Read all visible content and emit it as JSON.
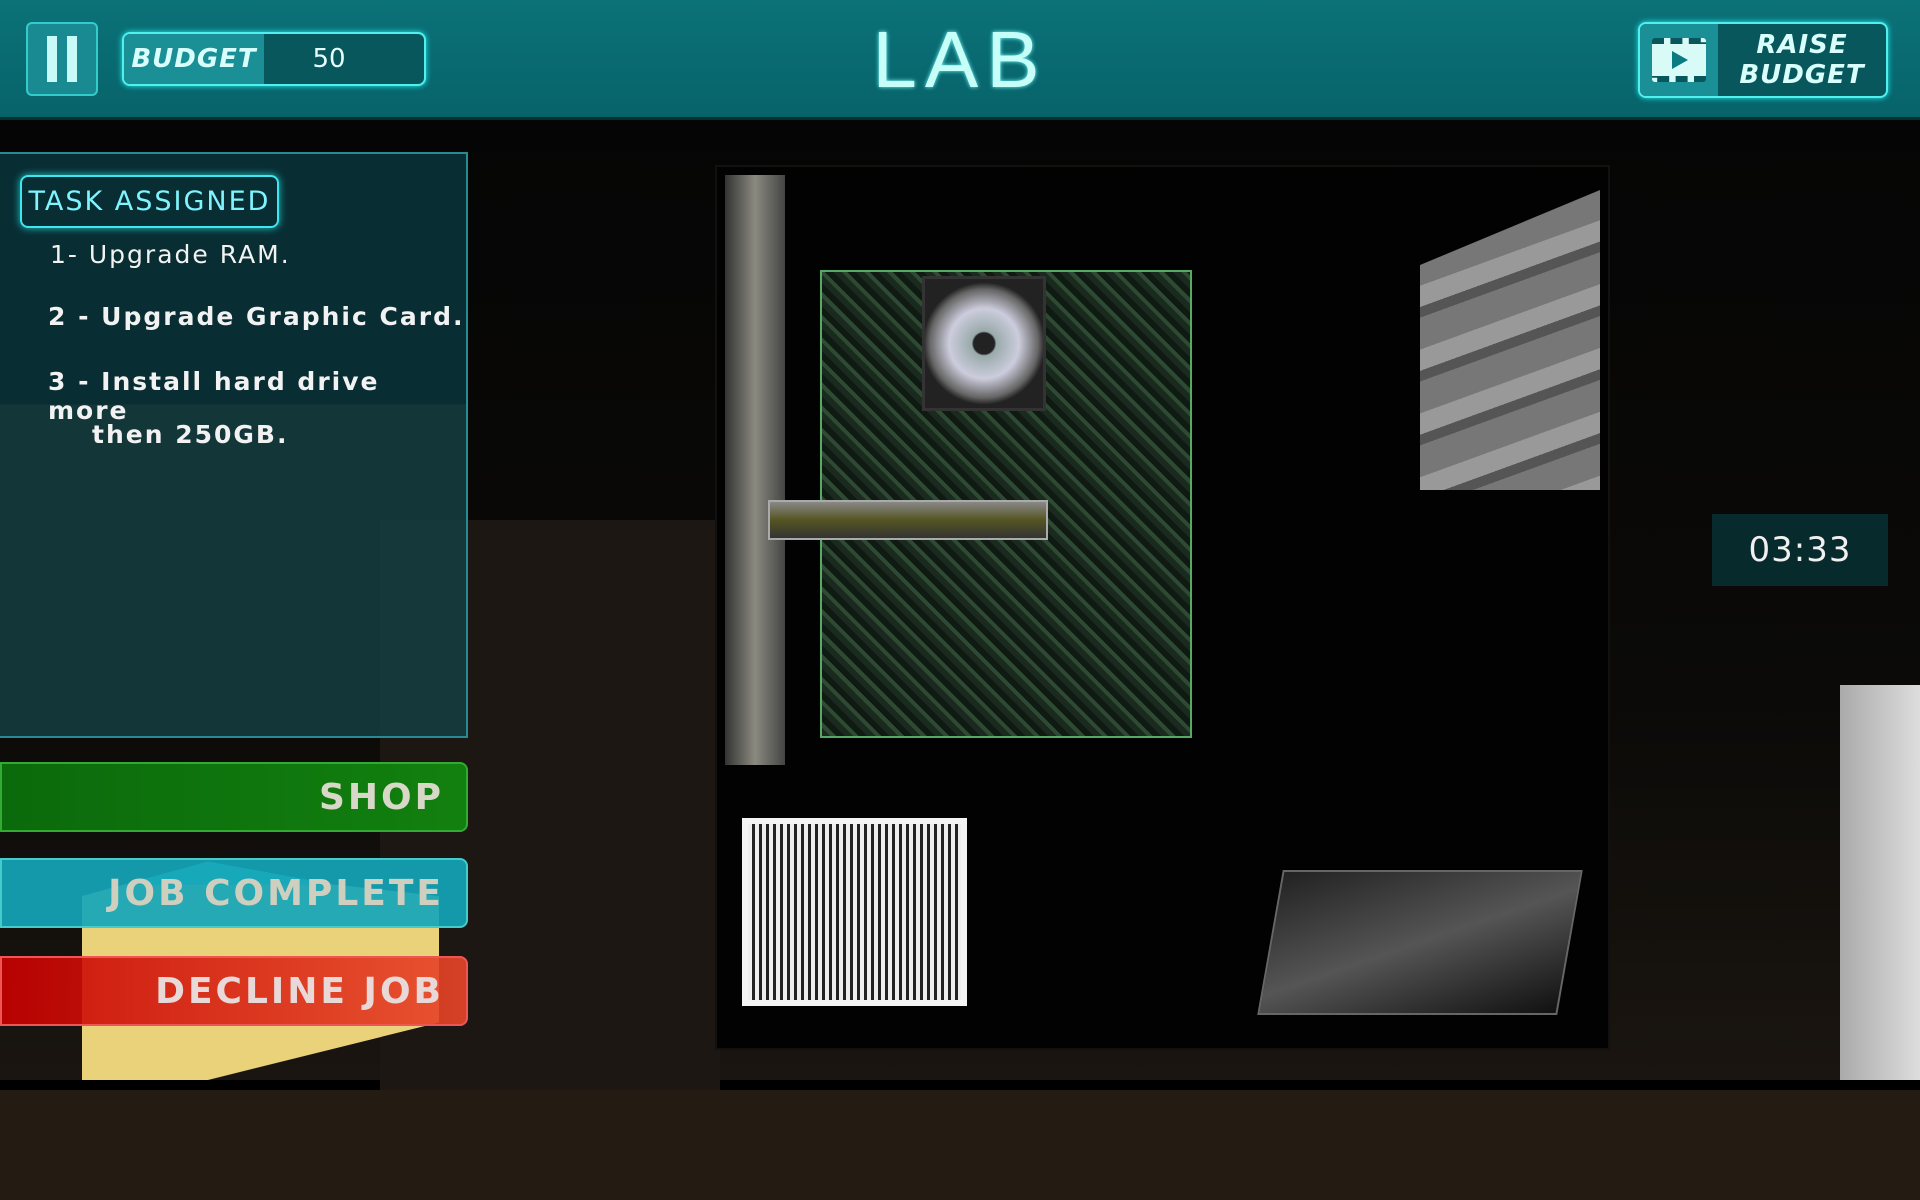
{
  "header": {
    "title": "LAB",
    "budget_label": "BUDGET",
    "budget_value": "50",
    "raise_budget_label": "RAISE BUDGET",
    "pause_icon": "pause-icon",
    "raise_icon": "video-play-icon"
  },
  "tasks": {
    "heading": "TASK ASSIGNED",
    "items": [
      "1- Upgrade RAM.",
      "2 - Upgrade Graphic Card.",
      "3 - Install hard drive more",
      "then 250GB."
    ]
  },
  "actions": {
    "shop": "SHOP",
    "job_complete": "JOB COMPLETE",
    "decline_job": "DECLINE JOB"
  },
  "timer": "03:33",
  "colors": {
    "header": "#0b7278",
    "accent": "#3de6f0",
    "shop": "#12800f",
    "job_complete": "#14a5b9",
    "decline": "#d01a10"
  }
}
